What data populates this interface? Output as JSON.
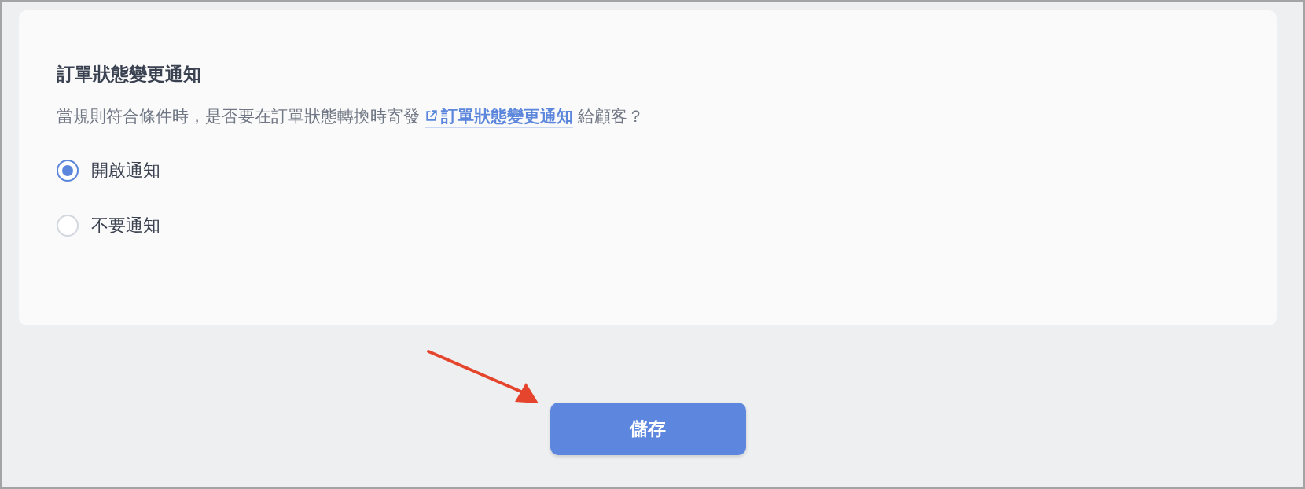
{
  "section": {
    "title": "訂單狀態變更通知",
    "description": {
      "before": "當規則符合條件時，是否要在訂單狀態轉換時寄發",
      "link": "訂單狀態變更通知",
      "after": "給顧客？"
    }
  },
  "options": [
    {
      "label": "開啟通知",
      "selected": true
    },
    {
      "label": "不要通知",
      "selected": false
    }
  ],
  "save_button": "儲存"
}
